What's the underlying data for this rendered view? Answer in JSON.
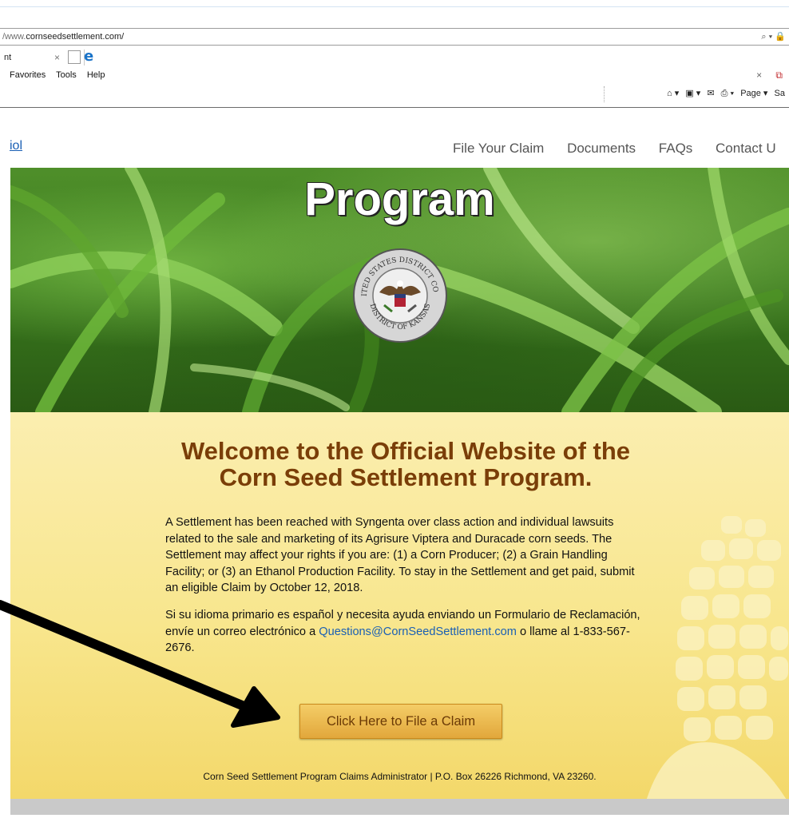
{
  "browser": {
    "url_prefix": "/www.",
    "url_domain": "cornseedsettlement.com/",
    "address_icons": "⌕ ▾ 🔒",
    "tab_title": "nt",
    "tab_close": "×",
    "menu": [
      "Favorites",
      "Tools",
      "Help"
    ],
    "menu_right_close": "×",
    "command": [
      "⌂ ▾",
      "▣ ▾",
      "✉",
      "⎙ ▾",
      "Page ▾",
      "Sa"
    ]
  },
  "page": {
    "lang_link": "iol",
    "nav": [
      "File Your Claim",
      "Documents",
      "FAQs",
      "Contact U"
    ],
    "hero_title": "Program",
    "seal": {
      "top_text": "UNITED STATES DISTRICT COURT",
      "bottom_text": "DISTRICT OF KANSAS"
    },
    "welcome_heading": "Welcome to the Official Website of the Corn Seed Settlement Program.",
    "paragraph1": "A Settlement has been reached with Syngenta over class action and individual lawsuits related to the sale and marketing of its Agrisure Viptera and Duracade corn seeds. The Settlement may affect your rights if you are: (1) a Corn Producer; (2) a Grain Handling Facility; or (3) an Ethanol Production Facility. To stay in the Settlement and get paid, submit an eligible Claim by October 12, 2018.",
    "paragraph2_pre": "Si su idioma primario es español y necesita ayuda enviando un Formulario de Reclamación, envíe un correo electrónico a ",
    "paragraph2_email": "Questions@CornSeedSettlement.com",
    "paragraph2_post": " o llame al 1-833-567-2676.",
    "claim_button": "Click Here to File a Claim",
    "footer": "Corn Seed Settlement Program Claims Administrator | P.O. Box 26226 Richmond, VA 23260."
  },
  "colors": {
    "heading": "#7a3e08",
    "link": "#1a5fb4",
    "button": "#e9b24a",
    "content_bg": "#f8e68d"
  }
}
